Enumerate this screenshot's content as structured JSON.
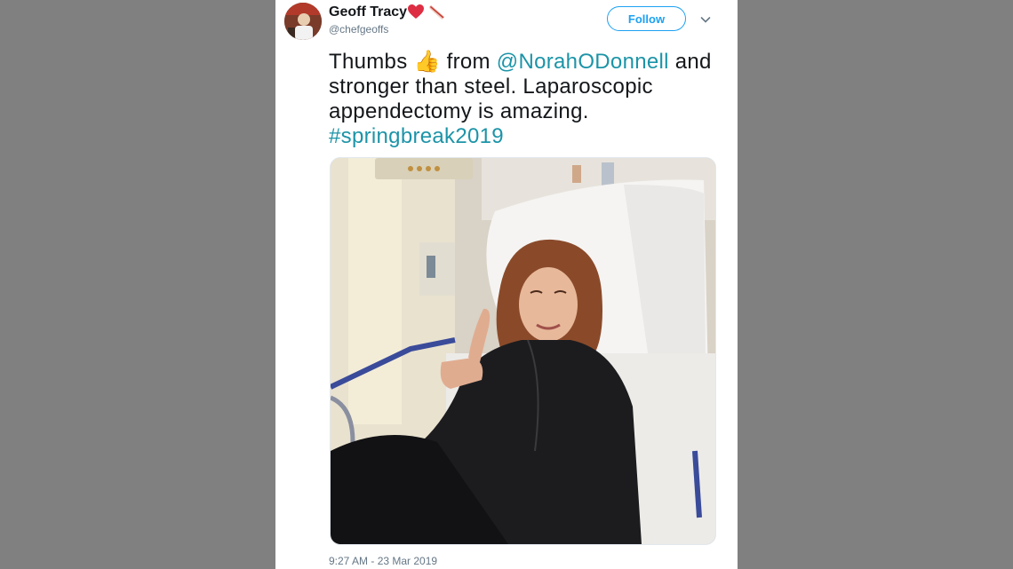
{
  "tweet": {
    "display_name": "Geoff Tracy",
    "badges": [
      "red-heart-icon",
      "bacon-icon"
    ],
    "handle": "@chefgeoffs",
    "follow_label": "Follow",
    "text_parts": {
      "part1": "Thumbs ",
      "emoji": "👍",
      "part2": " from ",
      "mention": "@NorahODonnell",
      "part3": " and stronger than steel. Laparoscopic appendectomy is amazing. ",
      "hashtag": "#springbreak2019"
    },
    "media": {
      "icon": "photo-hospital-bed"
    },
    "timestamp": "9:27 AM - 23 Mar 2019"
  },
  "colors": {
    "background": "#808080",
    "card": "#ffffff",
    "accent": "#1da1f2",
    "link": "#1c94a8",
    "text": "#14171a",
    "muted": "#657786"
  }
}
